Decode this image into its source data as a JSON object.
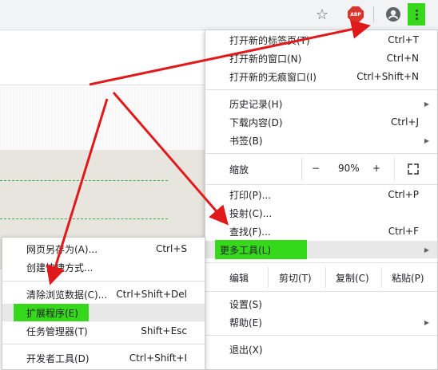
{
  "colors": {
    "highlight": "#36d81c",
    "arrow": "#e0191b"
  },
  "toolbar": {
    "bookmark_icon": "star-icon",
    "abp_label": "ABP",
    "profile_icon": "account-icon",
    "menu_icon": "kebab-menu-icon"
  },
  "main_menu": {
    "new_tab": {
      "label": "打开新的标签页(T)",
      "shortcut": "Ctrl+T"
    },
    "new_window": {
      "label": "打开新的窗口(N)",
      "shortcut": "Ctrl+N"
    },
    "incognito": {
      "label": "打开新的无痕窗口(I)",
      "shortcut": "Ctrl+Shift+N"
    },
    "history": {
      "label": "历史记录(H)"
    },
    "downloads": {
      "label": "下载内容(D)",
      "shortcut": "Ctrl+J"
    },
    "bookmarks": {
      "label": "书签(B)"
    },
    "zoom": {
      "label": "缩放",
      "minus": "−",
      "value": "90%",
      "plus": "+"
    },
    "print": {
      "label": "打印(P)...",
      "shortcut": "Ctrl+P"
    },
    "cast": {
      "label": "投射(C)..."
    },
    "find": {
      "label": "查找(F)...",
      "shortcut": "Ctrl+F"
    },
    "more_tools": {
      "label": "更多工具(L)"
    },
    "edit": {
      "label": "编辑",
      "cut": "剪切(T)",
      "copy": "复制(C)",
      "paste": "粘贴(P)"
    },
    "settings": {
      "label": "设置(S)"
    },
    "help": {
      "label": "帮助(E)"
    },
    "exit": {
      "label": "退出(X)"
    }
  },
  "sub_menu": {
    "save_page": {
      "label": "网页另存为(A)...",
      "shortcut": "Ctrl+S"
    },
    "create_shortcut": {
      "label": "创建快捷方式..."
    },
    "clear_data": {
      "label": "清除浏览数据(C)...",
      "shortcut": "Ctrl+Shift+Del"
    },
    "extensions": {
      "label": "扩展程序(E)"
    },
    "task_manager": {
      "label": "任务管理器(T)",
      "shortcut": "Shift+Esc"
    },
    "dev_tools": {
      "label": "开发者工具(D)",
      "shortcut": "Ctrl+Shift+I"
    }
  }
}
